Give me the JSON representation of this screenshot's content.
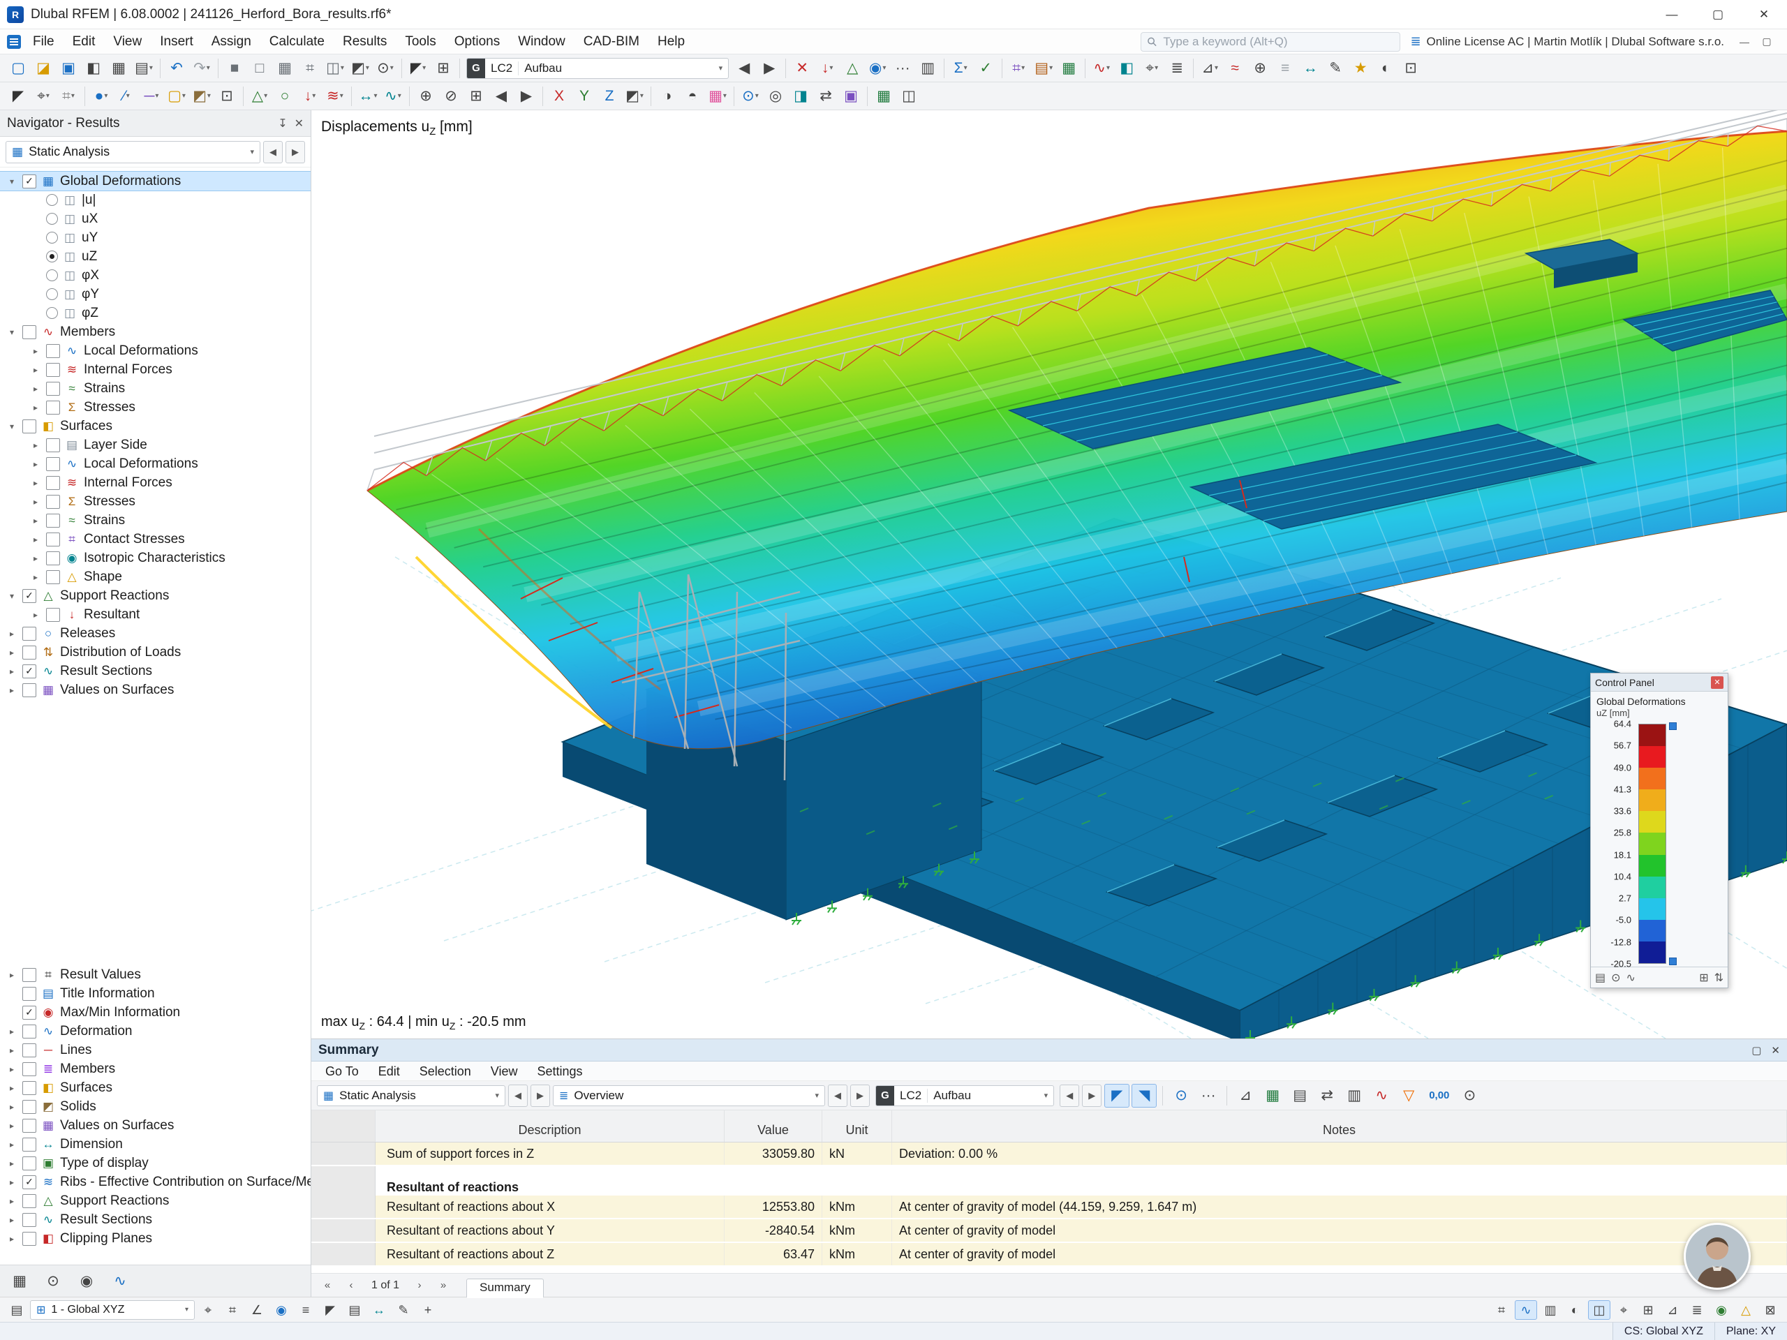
{
  "window": {
    "title": "Dlubal RFEM | 6.08.0002 | 241126_Herford_Bora_results.rf6*"
  },
  "menubar": {
    "items": [
      "File",
      "Edit",
      "View",
      "Insert",
      "Assign",
      "Calculate",
      "Results",
      "Tools",
      "Options",
      "Window",
      "CAD-BIM",
      "Help"
    ],
    "search_placeholder": "Type a keyword (Alt+Q)",
    "license": "Online License AC | Martin Motlík | Dlubal Software s.r.o."
  },
  "lc_selector": {
    "badge": "G",
    "case": "LC2",
    "name": "Aufbau"
  },
  "toolbar_row1": [
    {
      "n": "new-model",
      "g": "▢",
      "c": "#1a6fc4"
    },
    {
      "n": "open-model",
      "g": "◪",
      "c": "#d79b00"
    },
    {
      "n": "save-model",
      "g": "▣",
      "c": "#1a6fc4"
    },
    {
      "n": "navigator-panel",
      "g": "◧",
      "c": "#444444"
    },
    {
      "n": "tables-panel",
      "g": "▦",
      "c": "#444444"
    },
    {
      "n": "print-graphic",
      "g": "▤",
      "c": "#444444",
      "dd": 1
    },
    {
      "sep": 1
    },
    {
      "n": "undo",
      "g": "↶",
      "c": "#1a6fc4"
    },
    {
      "n": "redo",
      "g": "↷",
      "c": "#9aa0a6",
      "dd": 1
    },
    {
      "sep": 1
    },
    {
      "n": "view-solid",
      "g": "■",
      "c": "#6a7076"
    },
    {
      "n": "view-wireframe",
      "g": "□",
      "c": "#6a7076"
    },
    {
      "n": "view-solid-mesh",
      "g": "▦",
      "c": "#6a7076"
    },
    {
      "n": "view-numbering",
      "g": "⌗",
      "c": "#6a7076"
    },
    {
      "n": "render-sections",
      "g": "◫",
      "c": "#6a7076",
      "dd": 1
    },
    {
      "n": "isometric-view",
      "g": "◩",
      "c": "#444444",
      "dd": 1
    },
    {
      "n": "zoom-mode",
      "g": "⊙",
      "c": "#444444",
      "dd": 1
    },
    {
      "sep": 1
    },
    {
      "n": "select-mode",
      "g": "◤",
      "c": "#333333",
      "dd": 1
    },
    {
      "n": "box-zoom",
      "g": "⊞",
      "c": "#444444"
    },
    {
      "sep": 1
    },
    {
      "w": "lc"
    },
    {
      "n": "prev-load-case",
      "g": "◀",
      "c": "#444444"
    },
    {
      "n": "next-load-case",
      "g": "▶",
      "c": "#444444"
    },
    {
      "sep": 1
    },
    {
      "n": "delete-results",
      "g": "✕",
      "c": "#c62828"
    },
    {
      "n": "show-loads",
      "g": "↓",
      "c": "#c62828",
      "dd": 1
    },
    {
      "n": "show-supports",
      "g": "△",
      "c": "#2e7d32"
    },
    {
      "n": "show-result-values",
      "g": "◉",
      "c": "#1a6fc4",
      "dd": 1
    },
    {
      "n": "show-values",
      "g": "···",
      "c": "#444444"
    },
    {
      "n": "panel-toggle",
      "g": "▥",
      "c": "#444444"
    },
    {
      "sep": 1
    },
    {
      "n": "calculate-all",
      "g": "Σ",
      "c": "#1a6fc4",
      "dd": 1
    },
    {
      "n": "check-data",
      "g": "✓",
      "c": "#2e7d32"
    },
    {
      "sep": 1
    },
    {
      "n": "mesh-settings",
      "g": "⌗",
      "c": "#7a4fc0",
      "dd": 1
    },
    {
      "n": "printout-report",
      "g": "▤",
      "c": "#b05a10",
      "dd": 1
    },
    {
      "n": "export-xlsx",
      "g": "▦",
      "c": "#1f7a3d"
    },
    {
      "sep": 1
    },
    {
      "n": "section-views",
      "g": "∿",
      "c": "#c62828",
      "dd": 1
    },
    {
      "n": "clipping-box",
      "g": "◧",
      "c": "#00838f"
    },
    {
      "n": "user-defined-view",
      "g": "⌖",
      "c": "#444444",
      "dd": 1
    },
    {
      "n": "display-settings",
      "g": "≣",
      "c": "#444444"
    },
    {
      "sep": 1
    },
    {
      "n": "filter-objects",
      "g": "⊿",
      "c": "#444444",
      "dd": 1
    },
    {
      "n": "result-diagrams",
      "g": "≈",
      "c": "#c62828"
    },
    {
      "n": "object-snap",
      "g": "⊕",
      "c": "#444444"
    },
    {
      "n": "guide-lines",
      "g": "≡",
      "c": "#9aa0a6"
    },
    {
      "n": "measure",
      "g": "↔",
      "c": "#00838f"
    },
    {
      "n": "notes",
      "g": "✎",
      "c": "#444444"
    },
    {
      "n": "favorites",
      "g": "★",
      "c": "#d79b00"
    },
    {
      "n": "rendering-options",
      "g": "◐",
      "c": "#444444"
    },
    {
      "n": "full-screen",
      "g": "⊡",
      "c": "#444444"
    }
  ],
  "toolbar_row2": [
    {
      "n": "edit-mode",
      "g": "◤",
      "c": "#333333"
    },
    {
      "n": "snap-settings",
      "g": "⌖",
      "c": "#444444",
      "dd": 1
    },
    {
      "n": "work-plane",
      "g": "⌗",
      "c": "#888888",
      "dd": 1
    },
    {
      "sep": 1
    },
    {
      "n": "new-node",
      "g": "●",
      "c": "#1a6fc4",
      "dd": 1
    },
    {
      "n": "new-line",
      "g": "∕",
      "c": "#1a6fc4",
      "dd": 1
    },
    {
      "n": "new-member",
      "g": "─",
      "c": "#7a4fc0",
      "dd": 1
    },
    {
      "n": "new-surface",
      "g": "▢",
      "c": "#d79b00",
      "dd": 1
    },
    {
      "n": "new-solid",
      "g": "◩",
      "c": "#8a6d3b",
      "dd": 1
    },
    {
      "n": "new-opening",
      "g": "⊡",
      "c": "#444444"
    },
    {
      "sep": 1
    },
    {
      "n": "new-support",
      "g": "△",
      "c": "#2e7d32",
      "dd": 1
    },
    {
      "n": "new-hinge",
      "g": "○",
      "c": "#2e7d32"
    },
    {
      "n": "new-load",
      "g": "↓",
      "c": "#c62828",
      "dd": 1
    },
    {
      "n": "load-cases",
      "g": "≋",
      "c": "#c62828",
      "dd": 1
    },
    {
      "sep": 1
    },
    {
      "n": "dimensions",
      "g": "↔",
      "c": "#00838f",
      "dd": 1
    },
    {
      "n": "result-sections",
      "g": "∿",
      "c": "#00838f",
      "dd": 1
    },
    {
      "sep": 1
    },
    {
      "n": "zoom-in",
      "g": "⊕",
      "c": "#444444"
    },
    {
      "n": "zoom-out",
      "g": "⊘",
      "c": "#444444"
    },
    {
      "n": "zoom-all",
      "g": "⊞",
      "c": "#444444"
    },
    {
      "n": "previous-view",
      "g": "◀",
      "c": "#444444"
    },
    {
      "n": "next-view",
      "g": "▶",
      "c": "#444444"
    },
    {
      "sep": 1
    },
    {
      "n": "view-x",
      "g": "X",
      "c": "#c62828"
    },
    {
      "n": "view-y",
      "g": "Y",
      "c": "#2e7d32"
    },
    {
      "n": "view-z",
      "g": "Z",
      "c": "#1a6fc4"
    },
    {
      "n": "view-isometric",
      "g": "◩",
      "c": "#444444",
      "dd": 1
    },
    {
      "sep": 1
    },
    {
      "n": "shadow-mode",
      "g": "◑",
      "c": "#444444"
    },
    {
      "n": "transparency-mode",
      "g": "◓",
      "c": "#444444"
    },
    {
      "n": "color-scheme",
      "g": "▦",
      "c": "#e0529c",
      "dd": 1
    },
    {
      "sep": 1
    },
    {
      "n": "visibility-by-selection",
      "g": "⊙",
      "c": "#1a6fc4",
      "dd": 1
    },
    {
      "n": "visibility-all",
      "g": "◎",
      "c": "#444444"
    },
    {
      "n": "clipping-planes",
      "g": "◨",
      "c": "#00838f"
    },
    {
      "n": "move-rotate",
      "g": "⇄",
      "c": "#444444"
    },
    {
      "n": "copy-objects",
      "g": "▣",
      "c": "#7a4fc0"
    },
    {
      "sep": 1
    },
    {
      "n": "table-export",
      "g": "▦",
      "c": "#1f7a3d"
    },
    {
      "n": "screenshot",
      "g": "◫",
      "c": "#444444"
    }
  ],
  "navigator": {
    "title": "Navigator - Results",
    "combo": "Static Analysis",
    "tree_top": [
      {
        "d": 0,
        "a": "v",
        "c": "c",
        "g": "▦",
        "gc": "#1a6fc4",
        "t": "Global Deformations",
        "sel": 1
      },
      {
        "d": 1,
        "r": "off",
        "g": "◫",
        "gc": "#7d8a96",
        "t": "|u|"
      },
      {
        "d": 1,
        "r": "off",
        "g": "◫",
        "gc": "#7d8a96",
        "t": "uX"
      },
      {
        "d": 1,
        "r": "off",
        "g": "◫",
        "gc": "#7d8a96",
        "t": "uY"
      },
      {
        "d": 1,
        "r": "on",
        "g": "◫",
        "gc": "#7d8a96",
        "t": "uZ"
      },
      {
        "d": 1,
        "r": "off",
        "g": "◫",
        "gc": "#7d8a96",
        "t": "φX"
      },
      {
        "d": 1,
        "r": "off",
        "g": "◫",
        "gc": "#7d8a96",
        "t": "φY"
      },
      {
        "d": 1,
        "r": "off",
        "g": "◫",
        "gc": "#7d8a96",
        "t": "φZ"
      },
      {
        "d": 0,
        "a": "v",
        "c": "u",
        "g": "∿",
        "gc": "#c62828",
        "t": "Members"
      },
      {
        "d": 1,
        "a": ">",
        "c": "u",
        "g": "∿",
        "gc": "#1a6fc4",
        "t": "Local Deformations"
      },
      {
        "d": 1,
        "a": ">",
        "c": "u",
        "g": "≋",
        "gc": "#c62828",
        "t": "Internal Forces"
      },
      {
        "d": 1,
        "a": ">",
        "c": "u",
        "g": "≈",
        "gc": "#2e7d32",
        "t": "Strains"
      },
      {
        "d": 1,
        "a": ">",
        "c": "u",
        "g": "Σ",
        "gc": "#b06a10",
        "t": "Stresses"
      },
      {
        "d": 0,
        "a": "v",
        "c": "u",
        "g": "◧",
        "gc": "#d79b00",
        "t": "Surfaces"
      },
      {
        "d": 1,
        "a": ">",
        "c": "u",
        "g": "▤",
        "gc": "#7d8a96",
        "t": "Layer Side"
      },
      {
        "d": 1,
        "a": ">",
        "c": "u",
        "g": "∿",
        "gc": "#1a6fc4",
        "t": "Local Deformations"
      },
      {
        "d": 1,
        "a": ">",
        "c": "u",
        "g": "≋",
        "gc": "#c62828",
        "t": "Internal Forces"
      },
      {
        "d": 1,
        "a": ">",
        "c": "u",
        "g": "Σ",
        "gc": "#b06a10",
        "t": "Stresses"
      },
      {
        "d": 1,
        "a": ">",
        "c": "u",
        "g": "≈",
        "gc": "#2e7d32",
        "t": "Strains"
      },
      {
        "d": 1,
        "a": ">",
        "c": "u",
        "g": "⌗",
        "gc": "#7a4fc0",
        "t": "Contact Stresses"
      },
      {
        "d": 1,
        "a": ">",
        "c": "u",
        "g": "◉",
        "gc": "#00838f",
        "t": "Isotropic Characteristics"
      },
      {
        "d": 1,
        "a": ">",
        "c": "u",
        "g": "△",
        "gc": "#d79b00",
        "t": "Shape"
      },
      {
        "d": 0,
        "a": "v",
        "c": "c",
        "g": "△",
        "gc": "#2e7d32",
        "t": "Support Reactions"
      },
      {
        "d": 1,
        "a": ">",
        "c": "u",
        "g": "↓",
        "gc": "#c62828",
        "t": "Resultant"
      },
      {
        "d": 0,
        "a": ">",
        "c": "u",
        "g": "○",
        "gc": "#1a6fc4",
        "t": "Releases"
      },
      {
        "d": 0,
        "a": ">",
        "c": "u",
        "g": "⇅",
        "gc": "#b06a10",
        "t": "Distribution of Loads"
      },
      {
        "d": 0,
        "a": ">",
        "c": "c",
        "g": "∿",
        "gc": "#00838f",
        "t": "Result Sections"
      },
      {
        "d": 0,
        "a": ">",
        "c": "u",
        "g": "▦",
        "gc": "#7a4fc0",
        "t": "Values on Surfaces"
      }
    ],
    "tree_bottom": [
      {
        "d": 0,
        "a": ">",
        "c": "u",
        "g": "⌗",
        "gc": "#444444",
        "t": "Result Values"
      },
      {
        "d": 0,
        "a": "",
        "c": "u",
        "g": "▤",
        "gc": "#1a6fc4",
        "t": "Title Information"
      },
      {
        "d": 0,
        "a": "",
        "c": "c",
        "g": "◉",
        "gc": "#c62828",
        "t": "Max/Min Information"
      },
      {
        "d": 0,
        "a": ">",
        "c": "u",
        "g": "∿",
        "gc": "#1a6fc4",
        "t": "Deformation"
      },
      {
        "d": 0,
        "a": ">",
        "c": "u",
        "g": "─",
        "gc": "#c62828",
        "t": "Lines"
      },
      {
        "d": 0,
        "a": ">",
        "c": "u",
        "g": "≣",
        "gc": "#8a2be2",
        "t": "Members"
      },
      {
        "d": 0,
        "a": ">",
        "c": "u",
        "g": "◧",
        "gc": "#d79b00",
        "t": "Surfaces"
      },
      {
        "d": 0,
        "a": ">",
        "c": "u",
        "g": "◩",
        "gc": "#8a6d3b",
        "t": "Solids"
      },
      {
        "d": 0,
        "a": ">",
        "c": "u",
        "g": "▦",
        "gc": "#7a4fc0",
        "t": "Values on Surfaces"
      },
      {
        "d": 0,
        "a": ">",
        "c": "u",
        "g": "↔",
        "gc": "#00838f",
        "t": "Dimension"
      },
      {
        "d": 0,
        "a": ">",
        "c": "u",
        "g": "▣",
        "gc": "#2e7d32",
        "t": "Type of display"
      },
      {
        "d": 0,
        "a": ">",
        "c": "c",
        "g": "≋",
        "gc": "#1a6fc4",
        "t": "Ribs - Effective Contribution on Surface/Member"
      },
      {
        "d": 0,
        "a": ">",
        "c": "u",
        "g": "△",
        "gc": "#2e7d32",
        "t": "Support Reactions"
      },
      {
        "d": 0,
        "a": ">",
        "c": "u",
        "g": "∿",
        "gc": "#00838f",
        "t": "Result Sections"
      },
      {
        "d": 0,
        "a": ">",
        "c": "u",
        "g": "◧",
        "gc": "#c62828",
        "t": "Clipping Planes"
      }
    ],
    "footer_icons": [
      {
        "n": "tab-data",
        "g": "▦",
        "c": "#444444"
      },
      {
        "n": "tab-display",
        "g": "⊙",
        "c": "#444444"
      },
      {
        "n": "tab-views",
        "g": "◉",
        "c": "#444444"
      },
      {
        "n": "tab-results",
        "g": "∿",
        "c": "#1a6fc4"
      }
    ]
  },
  "viewport": {
    "title": {
      "prefix": "Displacements u",
      "sub": "Z",
      "suffix": " [mm]"
    },
    "status": {
      "p1": "max u",
      "s1": "Z",
      "v1": " : 64.4",
      "sep": " | ",
      "p2": "min u",
      "s2": "Z",
      "v2": " : -20.5 mm"
    }
  },
  "control_panel": {
    "title": "Control Panel",
    "group": "Global Deformations",
    "unit": "uZ [mm]",
    "values": [
      "64.4",
      "56.7",
      "49.0",
      "41.3",
      "33.6",
      "25.8",
      "18.1",
      "10.4",
      "2.7",
      "-5.0",
      "-12.8",
      "-20.5"
    ],
    "colors": [
      "#9b1313",
      "#e81a1f",
      "#f2701c",
      "#f0ad1b",
      "#ded81c",
      "#7fd41e",
      "#22c32c",
      "#1fcfa0",
      "#25c4ea",
      "#2163d6",
      "#101d96"
    ]
  },
  "summary": {
    "title": "Summary",
    "menu": [
      "Go To",
      "Edit",
      "Selection",
      "View",
      "Settings"
    ],
    "combo1": "Static Analysis",
    "combo2": "Overview",
    "lc": {
      "badge": "G",
      "case": "LC2",
      "name": "Aufbau"
    },
    "toolbar_icons": [
      {
        "n": "sum-pointer-select",
        "g": "◤",
        "c": "#1a6fc4",
        "act": 1
      },
      {
        "n": "sum-pointer-multi",
        "g": "◥",
        "c": "#1a6fc4",
        "act": 1
      },
      {
        "sep": 1
      },
      {
        "n": "sum-show-values",
        "g": "⊙",
        "c": "#1a6fc4"
      },
      {
        "n": "sum-values-xxx",
        "g": "···",
        "c": "#444444"
      },
      {
        "sep": 1
      },
      {
        "n": "sum-relations",
        "g": "⊿",
        "c": "#444444"
      },
      {
        "n": "sum-export-excel",
        "g": "▦",
        "c": "#1f7a3d"
      },
      {
        "n": "sum-print",
        "g": "▤",
        "c": "#444444"
      },
      {
        "n": "sum-transpose",
        "g": "⇄",
        "c": "#444444"
      },
      {
        "n": "sum-fixed-columns",
        "g": "▥",
        "c": "#444444"
      },
      {
        "n": "sum-chart",
        "g": "∿",
        "c": "#c62828"
      },
      {
        "n": "sum-filter",
        "g": "▽",
        "c": "#ef6c00"
      },
      {
        "n": "sum-decimals",
        "g": "0,00",
        "c": "#1a6fc4",
        "wide": 1
      },
      {
        "n": "sum-search",
        "g": "⊙",
        "c": "#444444"
      }
    ],
    "table": {
      "headers": [
        "Description",
        "Value",
        "Unit",
        "Notes"
      ],
      "rows": [
        {
          "type": "data",
          "desc": "Sum of support forces in Z",
          "value": "33059.80",
          "unit": "kN",
          "notes": "Deviation: 0.00 %"
        },
        {
          "type": "gap"
        },
        {
          "type": "section",
          "desc": "Resultant of reactions"
        },
        {
          "type": "data",
          "desc": "Resultant of reactions about X",
          "value": "12553.80",
          "unit": "kNm",
          "notes": "At center of gravity of model (44.159, 9.259, 1.647 m)"
        },
        {
          "type": "data",
          "desc": "Resultant of reactions about Y",
          "value": "-2840.54",
          "unit": "kNm",
          "notes": "At center of gravity of model"
        },
        {
          "type": "data",
          "desc": "Resultant of reactions about Z",
          "value": "63.47",
          "unit": "kNm",
          "notes": "At center of gravity of model"
        }
      ]
    },
    "pagination": "1 of 1",
    "tab": "Summary"
  },
  "bottombar": {
    "combo": "1 - Global XYZ",
    "icons": [
      {
        "n": "snap-toggle",
        "g": "⌖",
        "c": "#444444"
      },
      {
        "n": "grid-toggle",
        "g": "⌗",
        "c": "#444444"
      },
      {
        "n": "ortho-toggle",
        "g": "∠",
        "c": "#444444"
      },
      {
        "n": "osnap-toggle",
        "g": "◉",
        "c": "#1a6fc4"
      },
      {
        "n": "guidelines-toggle",
        "g": "≡",
        "c": "#444444"
      },
      {
        "n": "select-lock",
        "g": "◤",
        "c": "#444444"
      },
      {
        "n": "dxf-layers",
        "g": "▤",
        "c": "#444444"
      },
      {
        "n": "measure-tool",
        "g": "↔",
        "c": "#00838f"
      },
      {
        "n": "comment-tool",
        "g": "✎",
        "c": "#444444"
      },
      {
        "n": "coordinate-input",
        "g": "+",
        "c": "#444444"
      }
    ],
    "right_icons": [
      {
        "n": "status-mesh",
        "g": "⌗",
        "c": "#444444"
      },
      {
        "n": "status-results",
        "g": "∿",
        "c": "#1a6fc4",
        "act": 1
      },
      {
        "n": "status-panel",
        "g": "▥",
        "c": "#444444"
      },
      {
        "n": "status-render",
        "g": "◐",
        "c": "#444444"
      },
      {
        "n": "status-ghost",
        "g": "◫",
        "c": "#444444",
        "act": 1
      },
      {
        "n": "status-snap",
        "g": "⌖",
        "c": "#444444"
      },
      {
        "n": "status-grid",
        "g": "⊞",
        "c": "#444444"
      },
      {
        "n": "status-cad",
        "g": "⊿",
        "c": "#444444"
      },
      {
        "n": "status-layers",
        "g": "≣",
        "c": "#444444"
      },
      {
        "n": "status-ok",
        "g": "◉",
        "c": "#2e7d32"
      },
      {
        "n": "status-warning",
        "g": "△",
        "c": "#d79b00"
      },
      {
        "n": "status-lock",
        "g": "⊠",
        "c": "#444444"
      }
    ]
  },
  "statusbar": {
    "cs": "CS: Global XYZ",
    "plane": "Plane: XY"
  }
}
